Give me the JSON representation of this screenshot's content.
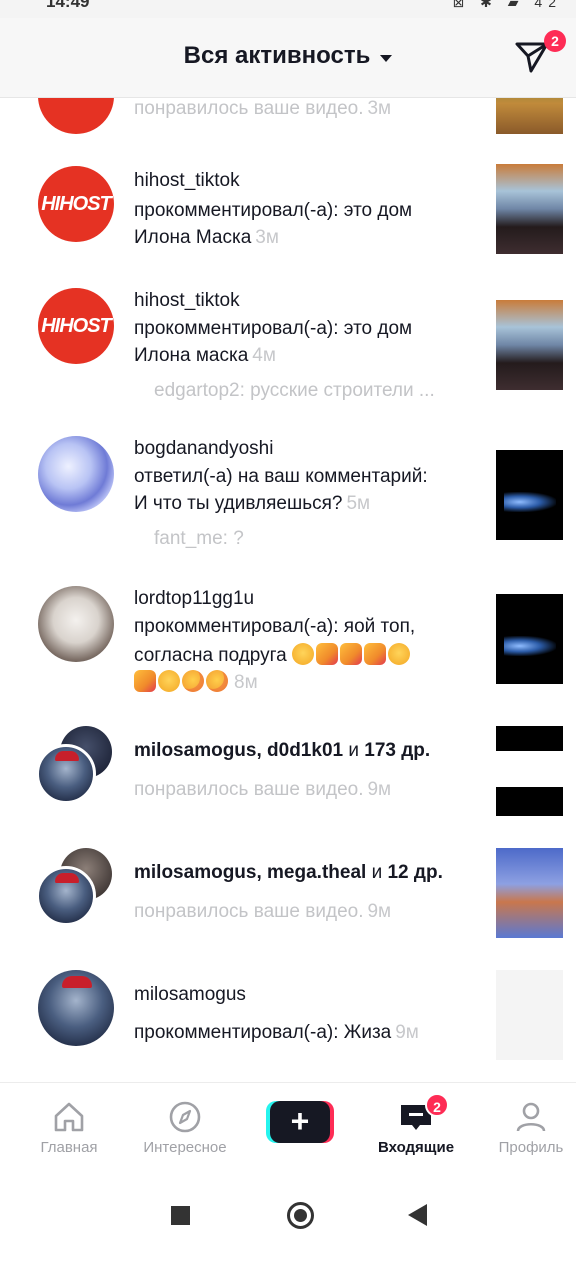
{
  "status_bar": {
    "time": "14:49",
    "icons": "⊠ ✱ ▰ 42"
  },
  "header": {
    "title": "Вся активность",
    "dm_badge": "2"
  },
  "notifications": [
    {
      "action": "понравилось ваше видео.",
      "time": "3м"
    },
    {
      "username": "hihost_tiktok",
      "avatar_text": "HIHOST",
      "line1": "прокомментировал(-а): это дом",
      "line2": "Илона Маска",
      "time": "3м"
    },
    {
      "username": "hihost_tiktok",
      "avatar_text": "HIHOST",
      "line1": "прокомментировал(-а): это дом",
      "line2": "Илона маска",
      "time": "4м",
      "reply": "edgartop2: русские строители ..."
    },
    {
      "username": "bogdanandyoshi",
      "line1": "ответил(-а) на ваш комментарий:",
      "line2": "И что ты удивляешься?",
      "time": "5м",
      "reply": "fant_me: ?"
    },
    {
      "username": "lordtop11gg1u",
      "line1": "прокомментировал(-а): яой топ,",
      "line2": "согласна подруга",
      "time": "8м"
    },
    {
      "users": "milosamogus, d0d1k01",
      "and_text": "и",
      "others": "173 др.",
      "action": "понравилось ваше видео.",
      "time": "9м"
    },
    {
      "users": "milosamogus, mega.theal",
      "and_text": "и",
      "others": "12 др.",
      "action": "понравилось ваше видео.",
      "time": "9м"
    },
    {
      "username": "milosamogus",
      "line1": "прокомментировал(-а): Жиза",
      "time": "9м"
    }
  ],
  "bottom_nav": {
    "home": "Главная",
    "discover": "Интересное",
    "create": "+",
    "inbox": "Входящие",
    "inbox_badge": "2",
    "profile": "Профиль"
  },
  "colors": {
    "accent": "#fe2c55",
    "cyan": "#25f4ee",
    "text": "#161823",
    "muted": "#c3c4c7"
  }
}
